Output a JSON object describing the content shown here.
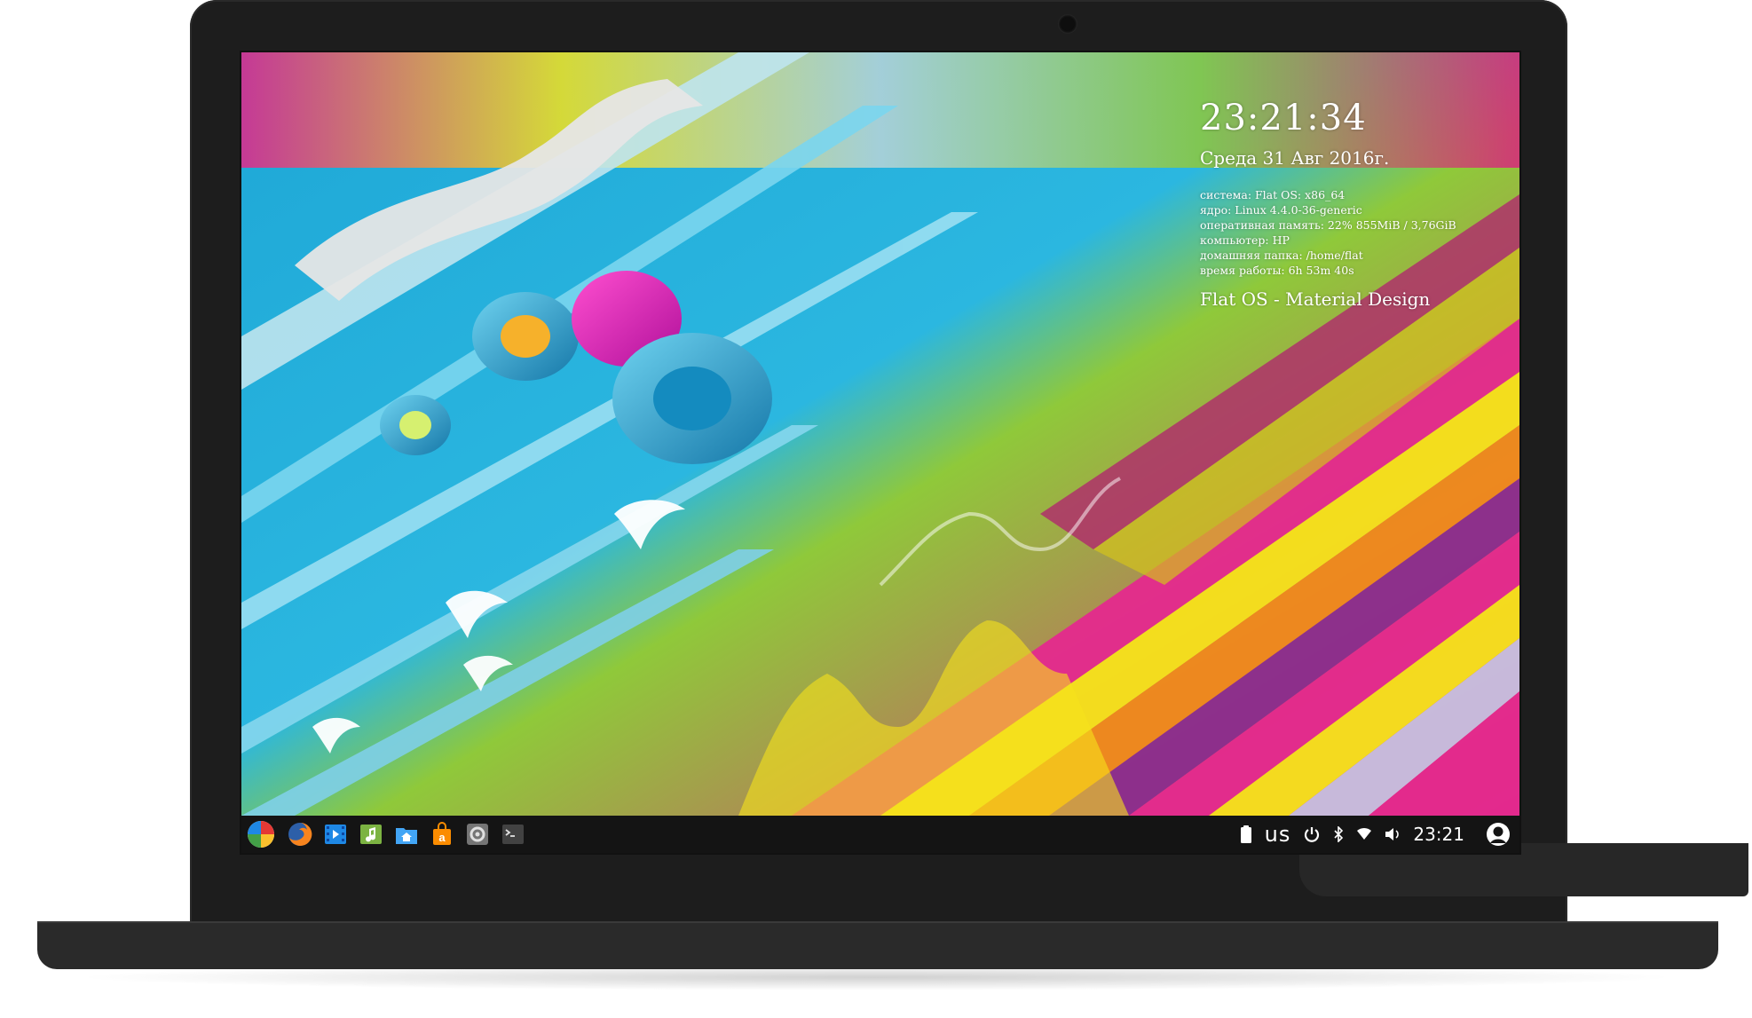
{
  "desktop": {
    "conky": {
      "clock": "23:21:34",
      "date": "Среда 31 Авг 2016г.",
      "info": [
        "система: Flat OS: x86_64",
        "ядро: Linux 4.4.0-36-generic",
        "оперативная память: 22% 855MiB / 3,76GiB",
        "компьютер: HP",
        "домашняя папка: /home/flat",
        "время работы: 6h 53m 40s"
      ],
      "brand": "Flat OS - Material Design"
    }
  },
  "taskbar": {
    "launchers": [
      {
        "name": "app-menu",
        "icon": "flat-os-logo-icon"
      },
      {
        "name": "firefox",
        "icon": "firefox-icon"
      },
      {
        "name": "video-player",
        "icon": "film-icon"
      },
      {
        "name": "music-player",
        "icon": "music-icon"
      },
      {
        "name": "file-manager",
        "icon": "home-folder-icon"
      },
      {
        "name": "app-store",
        "icon": "shopping-bag-icon"
      },
      {
        "name": "system-settings",
        "icon": "settings-icon"
      },
      {
        "name": "terminal",
        "icon": "terminal-icon"
      }
    ],
    "tray": {
      "keyboard_layout": "us",
      "clock": "23:21"
    }
  },
  "colors": {
    "taskbar_bg": "#141414",
    "laptop_body": "#1d1d1d",
    "laptop_base": "#2a2a2a",
    "conky_text": "#ffffff"
  }
}
